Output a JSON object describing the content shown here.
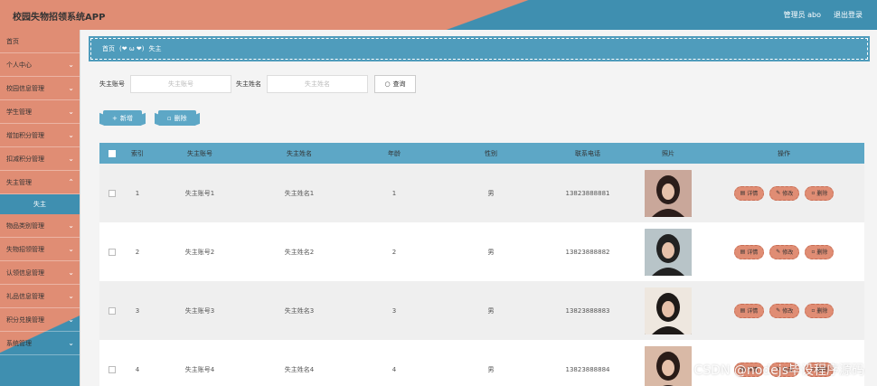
{
  "header": {
    "title": "校园失物招领系统APP",
    "user_label": "管理员 abo",
    "logout": "退出登录"
  },
  "sidebar": {
    "items": [
      {
        "label": "首页",
        "arrow": false
      },
      {
        "label": "个人中心",
        "arrow": true
      },
      {
        "label": "校园信息管理",
        "arrow": true
      },
      {
        "label": "学生管理",
        "arrow": true
      },
      {
        "label": "增加积分管理",
        "arrow": true
      },
      {
        "label": "扣减积分管理",
        "arrow": true
      },
      {
        "label": "失主管理",
        "arrow": true
      }
    ],
    "active_sub": "失主",
    "items_after": [
      {
        "label": "物品类别管理"
      },
      {
        "label": "失物招领管理"
      },
      {
        "label": "认领信息管理"
      },
      {
        "label": "礼品信息管理"
      },
      {
        "label": "积分兑换管理"
      },
      {
        "label": "系统管理"
      }
    ]
  },
  "breadcrumb": {
    "home": "首页",
    "emoji": "(❤ ω ❤)",
    "current": "失主"
  },
  "search": {
    "account_label": "失主账号",
    "account_placeholder": "失主账号",
    "name_label": "失主姓名",
    "name_placeholder": "失主姓名",
    "button": "查询"
  },
  "actions": {
    "add": "新增",
    "delete": "删除"
  },
  "table": {
    "headers": [
      "索引",
      "失主账号",
      "失主姓名",
      "年龄",
      "性别",
      "联系电话",
      "照片",
      "操作"
    ],
    "rows": [
      {
        "idx": "1",
        "account": "失主账号1",
        "name": "失主姓名1",
        "age": "1",
        "gender": "男",
        "phone": "13823888881"
      },
      {
        "idx": "2",
        "account": "失主账号2",
        "name": "失主姓名2",
        "age": "2",
        "gender": "男",
        "phone": "13823888882"
      },
      {
        "idx": "3",
        "account": "失主账号3",
        "name": "失主姓名3",
        "age": "3",
        "gender": "男",
        "phone": "13823888883"
      },
      {
        "idx": "4",
        "account": "失主账号4",
        "name": "失主姓名4",
        "age": "4",
        "gender": "男",
        "phone": "13823888884"
      }
    ],
    "ops": {
      "detail": "详情",
      "edit": "修改",
      "delete": "删除"
    }
  },
  "watermark": "CSDN @nodejs毕设程序源码",
  "colors": {
    "accent": "#e08d74",
    "primary": "#3f8fb0"
  }
}
